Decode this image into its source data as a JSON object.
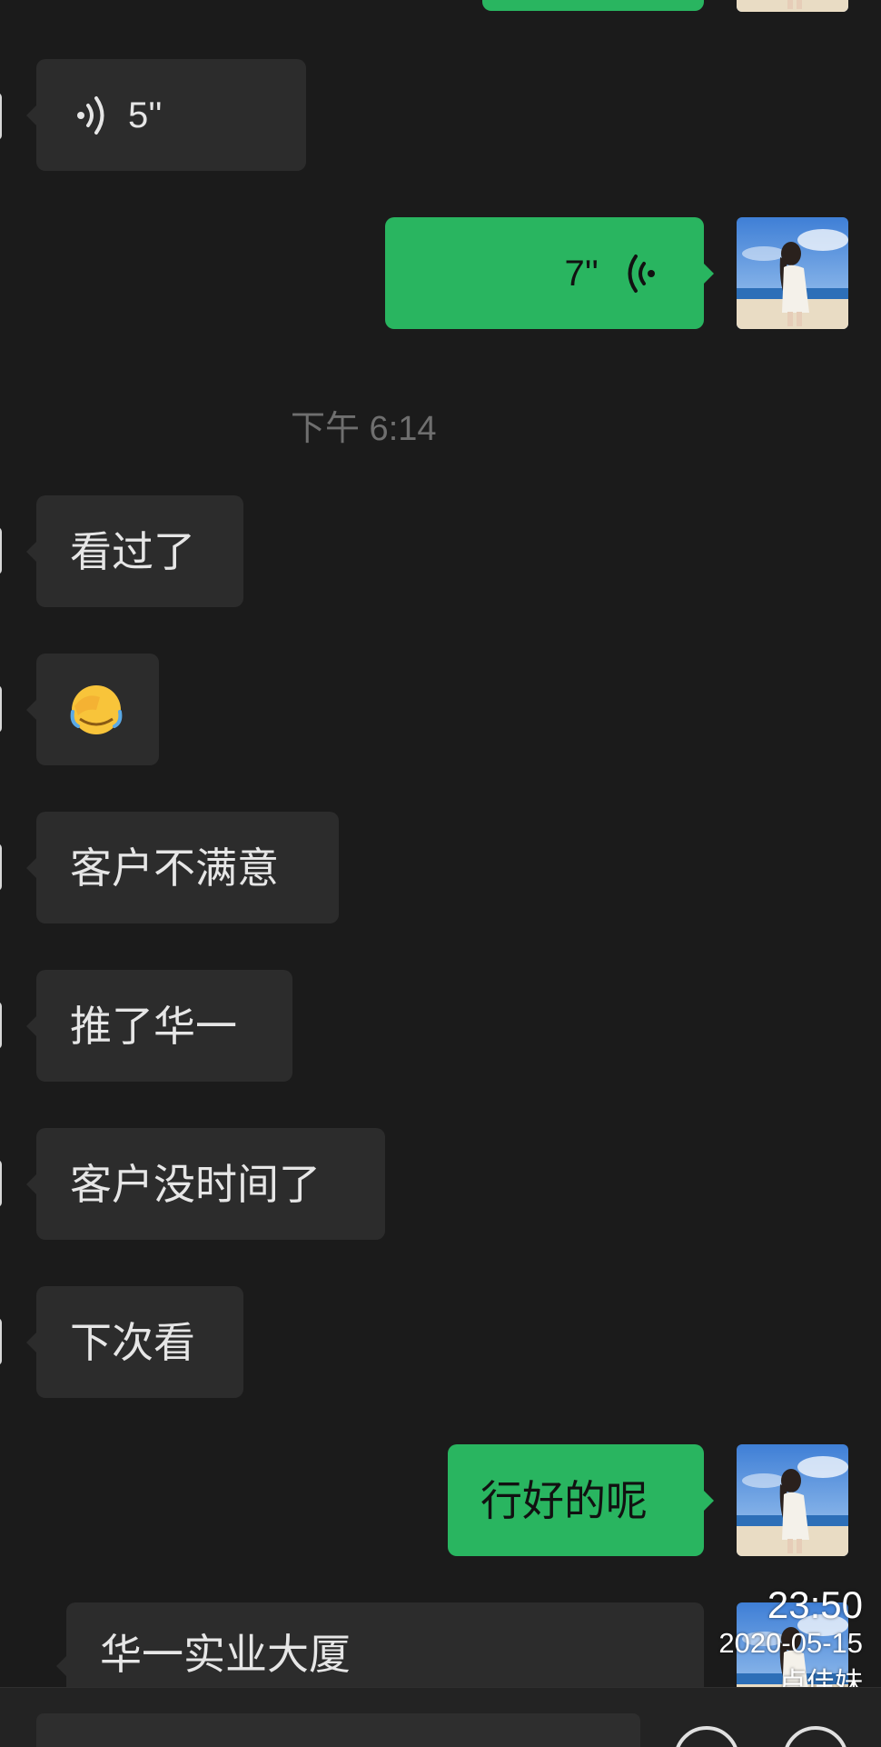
{
  "messages": {
    "voice_in_duration": "5''",
    "voice_out_duration": "7''",
    "timestamp": "下午 6:14",
    "in_1": "看过了",
    "in_2_emoji": "🤦",
    "in_3": "客户不满意",
    "in_4": "推了华一",
    "in_5": "客户没时间了",
    "in_6": "下次看",
    "out_1": "行好的呢",
    "card_title": "华一实业大厦"
  },
  "watermark": {
    "time": "23:50",
    "date": "2020-05-15",
    "name": "卢佳妹"
  },
  "colors": {
    "background": "#1b1b1b",
    "bubble_in": "#2c2c2c",
    "bubble_out": "#29b560",
    "timestamp": "#6f6f6f"
  },
  "icons": {
    "voice_in": "sound-wave-icon",
    "voice_out": "sound-wave-icon",
    "avatar": "user-avatar-photo"
  }
}
